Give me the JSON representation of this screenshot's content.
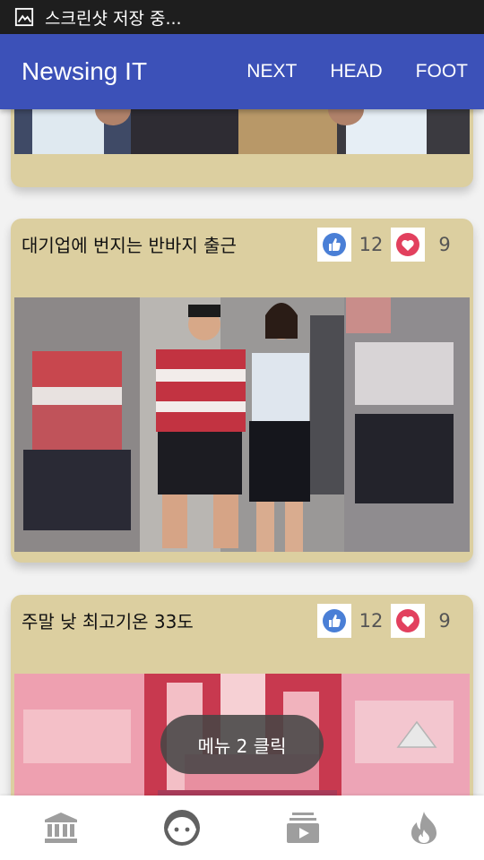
{
  "status_bar": {
    "notification_text": "스크린샷 저장 중...",
    "icon": "image-icon"
  },
  "app_bar": {
    "title": "Newsing IT",
    "actions": [
      {
        "label": "NEXT"
      },
      {
        "label": "HEAD"
      },
      {
        "label": "FOOT"
      }
    ]
  },
  "feed": {
    "cards": [
      {
        "headline": "대기업에 번지는 반바지 출근",
        "likes": "12",
        "hearts": "9",
        "image": "office-workers-photo"
      },
      {
        "headline": "주말 낮 최고기온 33도",
        "likes": "12",
        "hearts": "9",
        "image": "fountain-photo"
      }
    ]
  },
  "toast": {
    "text": "메뉴 2 클릭"
  },
  "bottom_nav": {
    "items": [
      {
        "icon": "bank-icon"
      },
      {
        "icon": "face-icon"
      },
      {
        "icon": "video-library-icon"
      },
      {
        "icon": "flame-icon"
      }
    ]
  },
  "colors": {
    "app_bar": "#3c51b8",
    "card": "#dccfa0",
    "status_bar": "#1e1e1e"
  }
}
